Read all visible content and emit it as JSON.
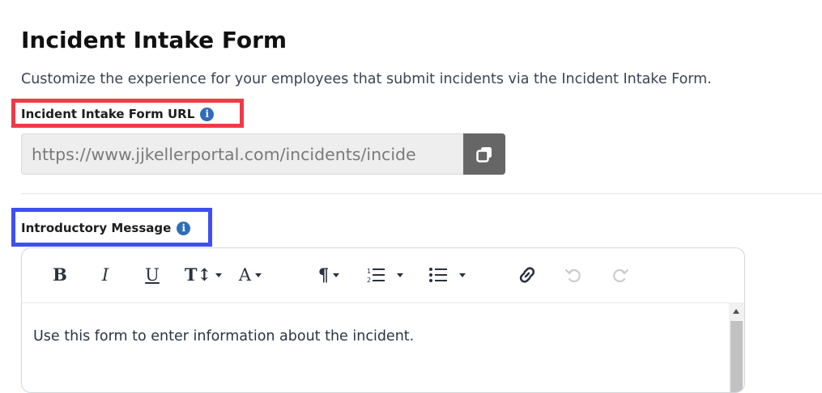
{
  "page": {
    "title": "Incident Intake Form",
    "description": "Customize the experience for your employees that submit incidents via the Incident Intake Form."
  },
  "url_field": {
    "label": "Incident Intake Form URL",
    "value": "https://www.jjkellerportal.com/incidents/incide",
    "info_icon": "info-icon",
    "copy_icon": "copy-icon"
  },
  "intro_field": {
    "label": "Introductory Message",
    "info_icon": "info-icon"
  },
  "editor": {
    "toolbar": {
      "bold": "B",
      "italic": "I",
      "underline": "U",
      "font_size": "T↕",
      "font_color": "A",
      "paragraph": "¶",
      "ordered_list": "ordered-list-icon",
      "bullet_list": "bullet-list-icon",
      "link": "link-icon",
      "undo": "undo-icon",
      "redo": "redo-icon"
    },
    "body_text": "Use this form to enter information about the incident."
  },
  "colors": {
    "highlight_red": "#ef3b45",
    "highlight_blue": "#3d4ff5",
    "info_icon": "#2f6db8",
    "copy_button": "#666666"
  }
}
